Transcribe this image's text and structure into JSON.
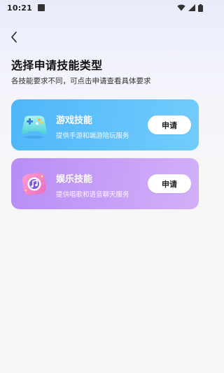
{
  "status_bar": {
    "time": "10:21"
  },
  "header": {
    "title": "选择申请技能类型",
    "subtitle": "各技能要求不同，可点击申请查看具体要求"
  },
  "cards": [
    {
      "title": "游戏技能",
      "description": "提供手游和端游陪玩服务",
      "button_label": "申请",
      "icon": "gamepad-icon",
      "color": "#5bbcf9"
    },
    {
      "title": "娱乐技能",
      "description": "提供唱歌和语音聊天服务",
      "button_label": "申请",
      "icon": "music-note-icon",
      "color": "#c39af7"
    }
  ]
}
